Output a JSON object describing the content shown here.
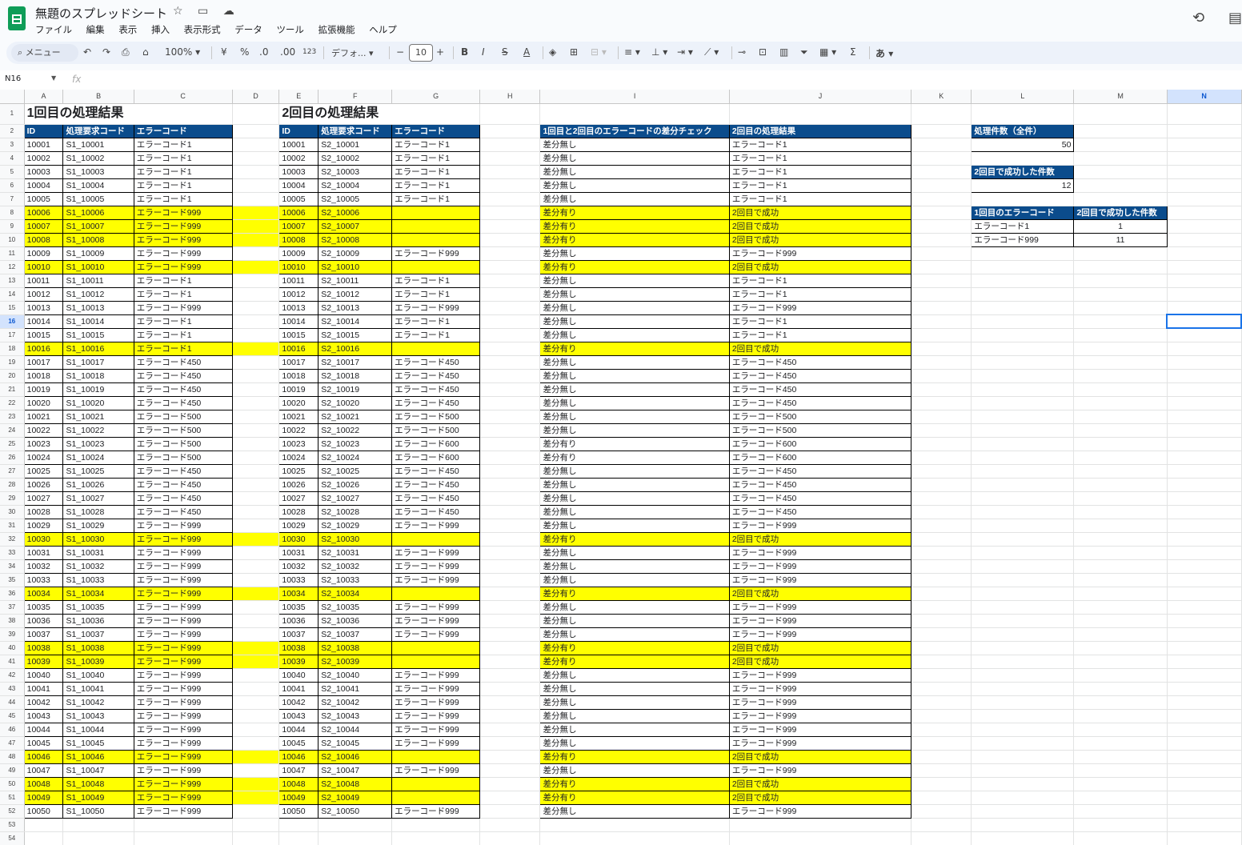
{
  "app": {
    "title": "無題のスプレッドシート",
    "menu": [
      "ファイル",
      "編集",
      "表示",
      "挿入",
      "表示形式",
      "データ",
      "ツール",
      "拡張機能",
      "ヘルプ"
    ]
  },
  "toolbar": {
    "search_label": "メニュー",
    "zoom": "100%",
    "currency": "¥",
    "percent": "%",
    "dec_decrease": ".0",
    "dec_increase": ".00",
    "number_format": "123",
    "font": "デフォ...",
    "font_size": "10",
    "bold": "B",
    "italic": "I",
    "strike": "S",
    "text_color": "A",
    "sigma": "Σ",
    "input_tool": "あ"
  },
  "formula_bar": {
    "name_box": "N16",
    "fx": "fx"
  },
  "columns": [
    "A",
    "B",
    "C",
    "D",
    "E",
    "F",
    "G",
    "H",
    "I",
    "J",
    "K",
    "L",
    "M",
    "N"
  ],
  "selected_column": "N",
  "selected_row": 16,
  "titles": {
    "run1": "1回目の処理結果",
    "run2": "2回目の処理結果"
  },
  "headers": {
    "run1": [
      "ID",
      "処理要求コード",
      "エラーコード"
    ],
    "run2": [
      "ID",
      "処理要求コード",
      "エラーコード"
    ],
    "diff": [
      "1回目と2回目のエラーコードの差分チェック",
      "2回目の処理結果"
    ]
  },
  "rows": [
    {
      "id": "10001",
      "c1": "エラーコード1",
      "c2": "エラーコード1",
      "diff": "差分無し",
      "result": "エラーコード1",
      "hl": false
    },
    {
      "id": "10002",
      "c1": "エラーコード1",
      "c2": "エラーコード1",
      "diff": "差分無し",
      "result": "エラーコード1",
      "hl": false
    },
    {
      "id": "10003",
      "c1": "エラーコード1",
      "c2": "エラーコード1",
      "diff": "差分無し",
      "result": "エラーコード1",
      "hl": false
    },
    {
      "id": "10004",
      "c1": "エラーコード1",
      "c2": "エラーコード1",
      "diff": "差分無し",
      "result": "エラーコード1",
      "hl": false
    },
    {
      "id": "10005",
      "c1": "エラーコード1",
      "c2": "エラーコード1",
      "diff": "差分無し",
      "result": "エラーコード1",
      "hl": false
    },
    {
      "id": "10006",
      "c1": "エラーコード999",
      "c2": "",
      "diff": "差分有り",
      "result": "2回目で成功",
      "hl": true
    },
    {
      "id": "10007",
      "c1": "エラーコード999",
      "c2": "",
      "diff": "差分有り",
      "result": "2回目で成功",
      "hl": true
    },
    {
      "id": "10008",
      "c1": "エラーコード999",
      "c2": "",
      "diff": "差分有り",
      "result": "2回目で成功",
      "hl": true
    },
    {
      "id": "10009",
      "c1": "エラーコード999",
      "c2": "エラーコード999",
      "diff": "差分無し",
      "result": "エラーコード999",
      "hl": false
    },
    {
      "id": "10010",
      "c1": "エラーコード999",
      "c2": "",
      "diff": "差分有り",
      "result": "2回目で成功",
      "hl": true
    },
    {
      "id": "10011",
      "c1": "エラーコード1",
      "c2": "エラーコード1",
      "diff": "差分無し",
      "result": "エラーコード1",
      "hl": false
    },
    {
      "id": "10012",
      "c1": "エラーコード1",
      "c2": "エラーコード1",
      "diff": "差分無し",
      "result": "エラーコード1",
      "hl": false
    },
    {
      "id": "10013",
      "c1": "エラーコード999",
      "c2": "エラーコード999",
      "diff": "差分無し",
      "result": "エラーコード999",
      "hl": false
    },
    {
      "id": "10014",
      "c1": "エラーコード1",
      "c2": "エラーコード1",
      "diff": "差分無し",
      "result": "エラーコード1",
      "hl": false
    },
    {
      "id": "10015",
      "c1": "エラーコード1",
      "c2": "エラーコード1",
      "diff": "差分無し",
      "result": "エラーコード1",
      "hl": false
    },
    {
      "id": "10016",
      "c1": "エラーコード1",
      "c2": "",
      "diff": "差分有り",
      "result": "2回目で成功",
      "hl": true
    },
    {
      "id": "10017",
      "c1": "エラーコード450",
      "c2": "エラーコード450",
      "diff": "差分無し",
      "result": "エラーコード450",
      "hl": false
    },
    {
      "id": "10018",
      "c1": "エラーコード450",
      "c2": "エラーコード450",
      "diff": "差分無し",
      "result": "エラーコード450",
      "hl": false
    },
    {
      "id": "10019",
      "c1": "エラーコード450",
      "c2": "エラーコード450",
      "diff": "差分無し",
      "result": "エラーコード450",
      "hl": false
    },
    {
      "id": "10020",
      "c1": "エラーコード450",
      "c2": "エラーコード450",
      "diff": "差分無し",
      "result": "エラーコード450",
      "hl": false
    },
    {
      "id": "10021",
      "c1": "エラーコード500",
      "c2": "エラーコード500",
      "diff": "差分無し",
      "result": "エラーコード500",
      "hl": false
    },
    {
      "id": "10022",
      "c1": "エラーコード500",
      "c2": "エラーコード500",
      "diff": "差分無し",
      "result": "エラーコード500",
      "hl": false
    },
    {
      "id": "10023",
      "c1": "エラーコード500",
      "c2": "エラーコード600",
      "diff": "差分有り",
      "result": "エラーコード600",
      "hl": false
    },
    {
      "id": "10024",
      "c1": "エラーコード500",
      "c2": "エラーコード600",
      "diff": "差分有り",
      "result": "エラーコード600",
      "hl": false
    },
    {
      "id": "10025",
      "c1": "エラーコード450",
      "c2": "エラーコード450",
      "diff": "差分無し",
      "result": "エラーコード450",
      "hl": false
    },
    {
      "id": "10026",
      "c1": "エラーコード450",
      "c2": "エラーコード450",
      "diff": "差分無し",
      "result": "エラーコード450",
      "hl": false
    },
    {
      "id": "10027",
      "c1": "エラーコード450",
      "c2": "エラーコード450",
      "diff": "差分無し",
      "result": "エラーコード450",
      "hl": false
    },
    {
      "id": "10028",
      "c1": "エラーコード450",
      "c2": "エラーコード450",
      "diff": "差分無し",
      "result": "エラーコード450",
      "hl": false
    },
    {
      "id": "10029",
      "c1": "エラーコード999",
      "c2": "エラーコード999",
      "diff": "差分無し",
      "result": "エラーコード999",
      "hl": false
    },
    {
      "id": "10030",
      "c1": "エラーコード999",
      "c2": "",
      "diff": "差分有り",
      "result": "2回目で成功",
      "hl": true
    },
    {
      "id": "10031",
      "c1": "エラーコード999",
      "c2": "エラーコード999",
      "diff": "差分無し",
      "result": "エラーコード999",
      "hl": false
    },
    {
      "id": "10032",
      "c1": "エラーコード999",
      "c2": "エラーコード999",
      "diff": "差分無し",
      "result": "エラーコード999",
      "hl": false
    },
    {
      "id": "10033",
      "c1": "エラーコード999",
      "c2": "エラーコード999",
      "diff": "差分無し",
      "result": "エラーコード999",
      "hl": false
    },
    {
      "id": "10034",
      "c1": "エラーコード999",
      "c2": "",
      "diff": "差分有り",
      "result": "2回目で成功",
      "hl": true
    },
    {
      "id": "10035",
      "c1": "エラーコード999",
      "c2": "エラーコード999",
      "diff": "差分無し",
      "result": "エラーコード999",
      "hl": false
    },
    {
      "id": "10036",
      "c1": "エラーコード999",
      "c2": "エラーコード999",
      "diff": "差分無し",
      "result": "エラーコード999",
      "hl": false
    },
    {
      "id": "10037",
      "c1": "エラーコード999",
      "c2": "エラーコード999",
      "diff": "差分無し",
      "result": "エラーコード999",
      "hl": false
    },
    {
      "id": "10038",
      "c1": "エラーコード999",
      "c2": "",
      "diff": "差分有り",
      "result": "2回目で成功",
      "hl": true
    },
    {
      "id": "10039",
      "c1": "エラーコード999",
      "c2": "",
      "diff": "差分有り",
      "result": "2回目で成功",
      "hl": true
    },
    {
      "id": "10040",
      "c1": "エラーコード999",
      "c2": "エラーコード999",
      "diff": "差分無し",
      "result": "エラーコード999",
      "hl": false
    },
    {
      "id": "10041",
      "c1": "エラーコード999",
      "c2": "エラーコード999",
      "diff": "差分無し",
      "result": "エラーコード999",
      "hl": false
    },
    {
      "id": "10042",
      "c1": "エラーコード999",
      "c2": "エラーコード999",
      "diff": "差分無し",
      "result": "エラーコード999",
      "hl": false
    },
    {
      "id": "10043",
      "c1": "エラーコード999",
      "c2": "エラーコード999",
      "diff": "差分無し",
      "result": "エラーコード999",
      "hl": false
    },
    {
      "id": "10044",
      "c1": "エラーコード999",
      "c2": "エラーコード999",
      "diff": "差分無し",
      "result": "エラーコード999",
      "hl": false
    },
    {
      "id": "10045",
      "c1": "エラーコード999",
      "c2": "エラーコード999",
      "diff": "差分無し",
      "result": "エラーコード999",
      "hl": false
    },
    {
      "id": "10046",
      "c1": "エラーコード999",
      "c2": "",
      "diff": "差分有り",
      "result": "2回目で成功",
      "hl": true
    },
    {
      "id": "10047",
      "c1": "エラーコード999",
      "c2": "エラーコード999",
      "diff": "差分無し",
      "result": "エラーコード999",
      "hl": false
    },
    {
      "id": "10048",
      "c1": "エラーコード999",
      "c2": "",
      "diff": "差分有り",
      "result": "2回目で成功",
      "hl": true
    },
    {
      "id": "10049",
      "c1": "エラーコード999",
      "c2": "",
      "diff": "差分有り",
      "result": "2回目で成功",
      "hl": true
    },
    {
      "id": "10050",
      "c1": "エラーコード999",
      "c2": "エラーコード999",
      "diff": "差分無し",
      "result": "エラーコード999",
      "hl": false
    }
  ],
  "summary": {
    "total_label": "処理件数（全件）",
    "total_value": "50",
    "success_label": "2回目で成功した件数",
    "success_value": "12",
    "breakdown_headers": [
      "1回目のエラーコード",
      "2回目で成功した件数"
    ],
    "breakdown": [
      {
        "code": "エラーコード1",
        "count": "1"
      },
      {
        "code": "エラーコード999",
        "count": "11"
      }
    ]
  },
  "colors": {
    "header_bg": "#0b4c8c",
    "highlight": "#ffff00",
    "select": "#1a73e8"
  }
}
